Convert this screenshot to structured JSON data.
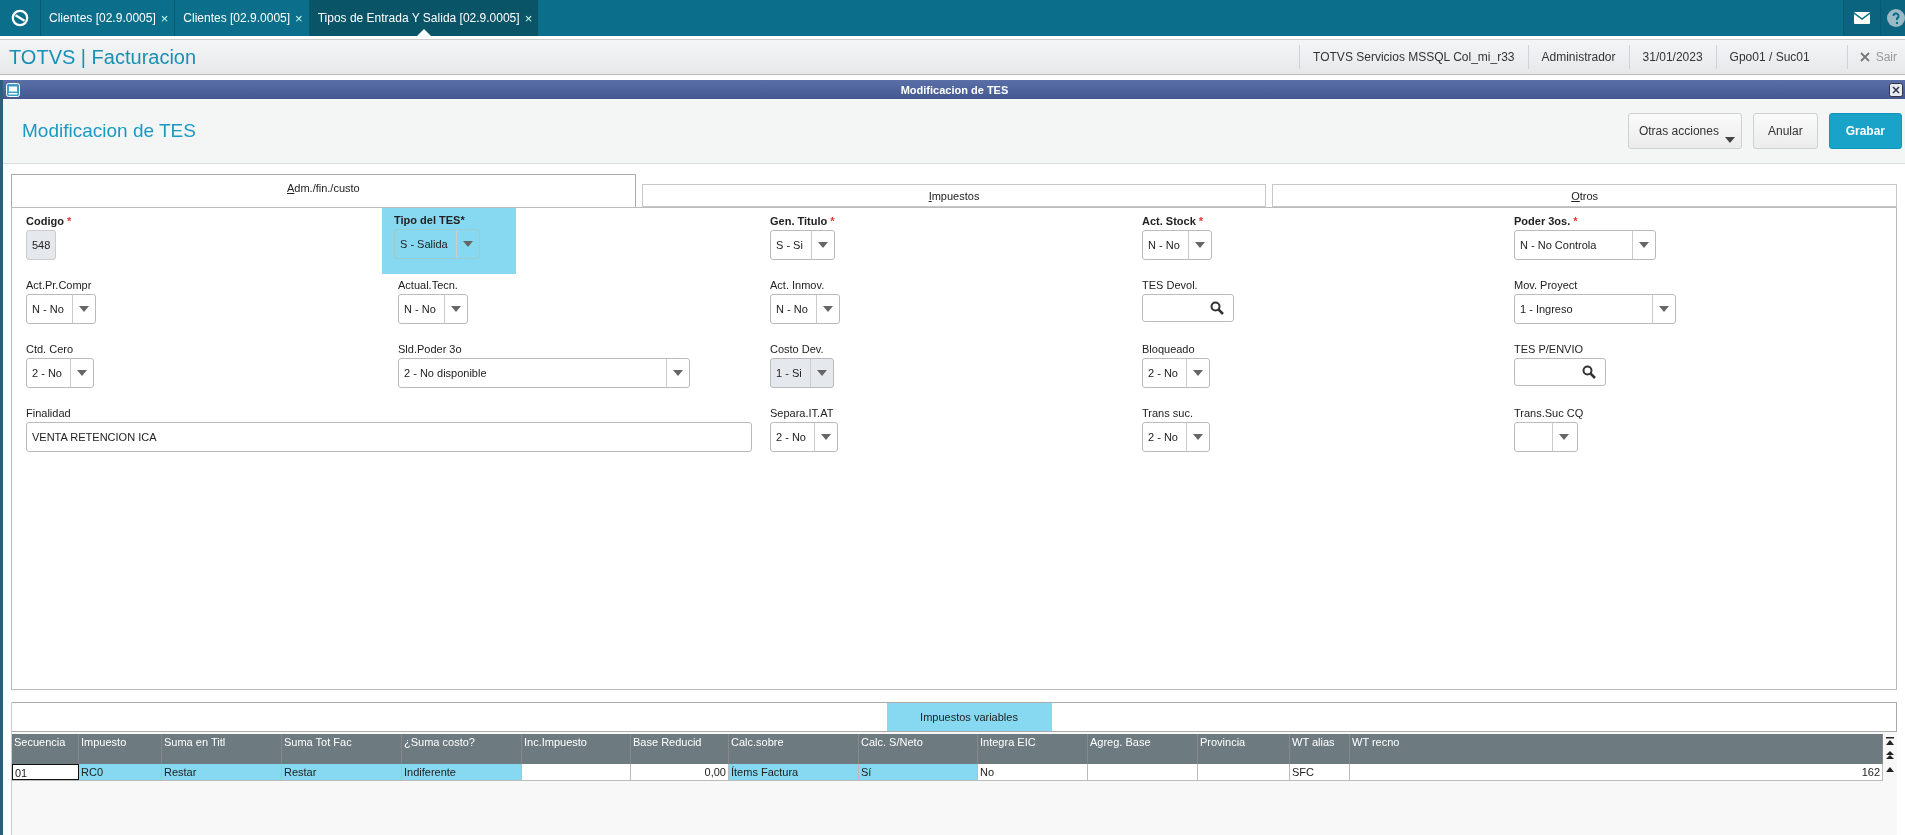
{
  "app_tabs": [
    {
      "label": "Clientes [02.9.0005]",
      "close": "×",
      "selected": false
    },
    {
      "label": "Clientes [02.9.0005]",
      "close": "×",
      "selected": false
    },
    {
      "label": "Tipos de Entrada Y Salida [02.9.0005]",
      "close": "×",
      "selected": true
    }
  ],
  "module_bar": {
    "title": "TOTVS | Facturacion",
    "info": [
      "TOTVS Servicios MSSQL Col_mi_r33",
      "Administrador",
      "31/01/2023",
      "Gpo01 / Suc01"
    ],
    "exit": "Sair"
  },
  "window": {
    "title": "Modificacion de TES"
  },
  "header": {
    "title": "Modificacion de TES",
    "buttons": [
      {
        "label": "Otras acciones",
        "kind": "menu"
      },
      {
        "label": "Anular",
        "kind": "plain"
      },
      {
        "label": "Grabar",
        "kind": "primary"
      }
    ]
  },
  "tabs": [
    {
      "label": "Adm./fin./custo",
      "selected": true
    },
    {
      "label": "Impuestos",
      "selected": false
    },
    {
      "label": "Otros",
      "selected": false
    }
  ],
  "fields": [
    {
      "label": "Codigo",
      "required_mark": "*",
      "kind": "readonly",
      "value": "548",
      "highlighted": false,
      "disabled": true
    },
    {
      "label": "Tipo del TES*",
      "kind": "select",
      "value": "S - Salida",
      "highlighted": true,
      "disabled": false
    },
    {
      "label": "Gen. Titulo",
      "required_mark": "*",
      "kind": "select",
      "value": "S - Si",
      "highlighted": false,
      "disabled": false
    },
    {
      "label": "Act. Stock",
      "required_mark": "*",
      "kind": "select",
      "value": "N - No",
      "highlighted": false,
      "disabled": false
    },
    {
      "label": "Poder 3os.",
      "required_mark": "*",
      "kind": "select",
      "value": "N - No Controla",
      "highlighted": false,
      "disabled": false
    },
    {
      "label": "Act.Pr.Compr",
      "kind": "select",
      "value": "N - No",
      "highlighted": false,
      "disabled": false
    },
    {
      "label": "Actual.Tecn.",
      "kind": "select",
      "value": "N - No",
      "highlighted": false,
      "disabled": false
    },
    {
      "label": "Act. Inmov.",
      "kind": "select",
      "value": "N - No",
      "highlighted": false,
      "disabled": false
    },
    {
      "label": "TES Devol.",
      "kind": "lookup",
      "highlighted": false,
      "disabled": false
    },
    {
      "label": "Mov. Proyect",
      "kind": "select",
      "value": "1 - Ingreso",
      "highlighted": false,
      "disabled": false
    },
    {
      "label": "Ctd. Cero",
      "kind": "select",
      "value": "2 - No",
      "highlighted": false,
      "disabled": false
    },
    {
      "label": "Sld.Poder 3o",
      "kind": "select",
      "value": "2 - No disponible",
      "highlighted": false,
      "disabled": false
    },
    {
      "label": "Costo Dev.",
      "kind": "select",
      "value": "1 - Si",
      "highlighted": false,
      "disabled": true
    },
    {
      "label": "Bloqueado",
      "kind": "select",
      "value": "2 - No",
      "highlighted": false,
      "disabled": false
    },
    {
      "label": "TES P/ENVIO",
      "kind": "lookup",
      "highlighted": false,
      "disabled": false
    },
    {
      "label": "Finalidad",
      "kind": "text",
      "value": "VENTA RETENCION ICA",
      "highlighted": false,
      "disabled": false
    },
    {
      "label": "Separa.IT.AT",
      "kind": "select",
      "value": "2 - No",
      "highlighted": false,
      "disabled": false
    },
    {
      "label": "Trans suc.",
      "kind": "select",
      "value": "2 - No",
      "highlighted": false,
      "disabled": false
    },
    {
      "label": "Trans.Suc CQ",
      "kind": "select",
      "highlighted": false,
      "disabled": false
    }
  ],
  "grid": {
    "tab": {
      "label": "Impuestos variables",
      "selected": true
    },
    "columns": [
      {
        "label": "Secuencia"
      },
      {
        "label": "Impuesto"
      },
      {
        "label": "Suma en Titl"
      },
      {
        "label": "Suma Tot Fac"
      },
      {
        "label": "¿Suma costo?"
      },
      {
        "label": "Inc.Impuesto"
      },
      {
        "label": "Base Reducid",
        "numeric": true
      },
      {
        "label": "Calc.sobre"
      },
      {
        "label": "Calc. S/Neto"
      },
      {
        "label": "Integra EIC"
      },
      {
        "label": "Agreg. Base"
      },
      {
        "label": "Provincia"
      },
      {
        "label": "WT alias"
      },
      {
        "label": "WT recno",
        "numeric": true
      }
    ],
    "rows": [
      {
        "cells": [
          {
            "text": "01",
            "highlighted": false,
            "focused": true
          },
          {
            "text": "RC0",
            "highlighted": true,
            "focused": false
          },
          {
            "text": "Restar",
            "highlighted": true,
            "focused": false
          },
          {
            "text": "Restar",
            "highlighted": true,
            "focused": false
          },
          {
            "text": "Indiferente",
            "highlighted": true,
            "focused": false
          },
          {
            "highlighted": false,
            "focused": false
          },
          {
            "text": "0,00",
            "highlighted": false,
            "focused": false
          },
          {
            "text": "Ítems Factura",
            "highlighted": true,
            "focused": false
          },
          {
            "text": "Sí",
            "highlighted": true,
            "focused": false
          },
          {
            "text": "No",
            "highlighted": false,
            "focused": false
          },
          {
            "highlighted": false,
            "focused": false
          },
          {
            "highlighted": false,
            "focused": false
          },
          {
            "text": "SFC",
            "highlighted": false,
            "focused": false
          },
          {
            "text": "162",
            "highlighted": false,
            "focused": false
          }
        ]
      }
    ]
  }
}
